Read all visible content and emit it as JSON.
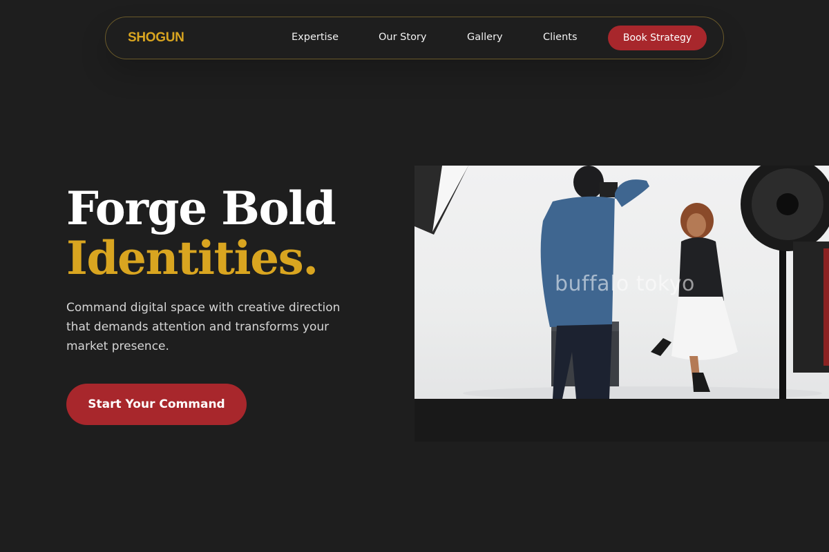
{
  "colors": {
    "background": "#1e1e1e",
    "accent_gold": "#d9a520",
    "accent_red": "#a8272c",
    "border_gold": "#6b5a2a"
  },
  "nav": {
    "logo": "SHOGUN",
    "links": [
      "Expertise",
      "Our Story",
      "Gallery",
      "Clients"
    ],
    "cta": "Book Strategy"
  },
  "hero": {
    "title_line1": "Forge Bold",
    "title_line2": "Identities.",
    "description": "Command digital space with creative direction that demands attention and transforms your market presence.",
    "cta": "Start Your Command"
  },
  "image": {
    "watermark": "buffalo tokyo"
  }
}
